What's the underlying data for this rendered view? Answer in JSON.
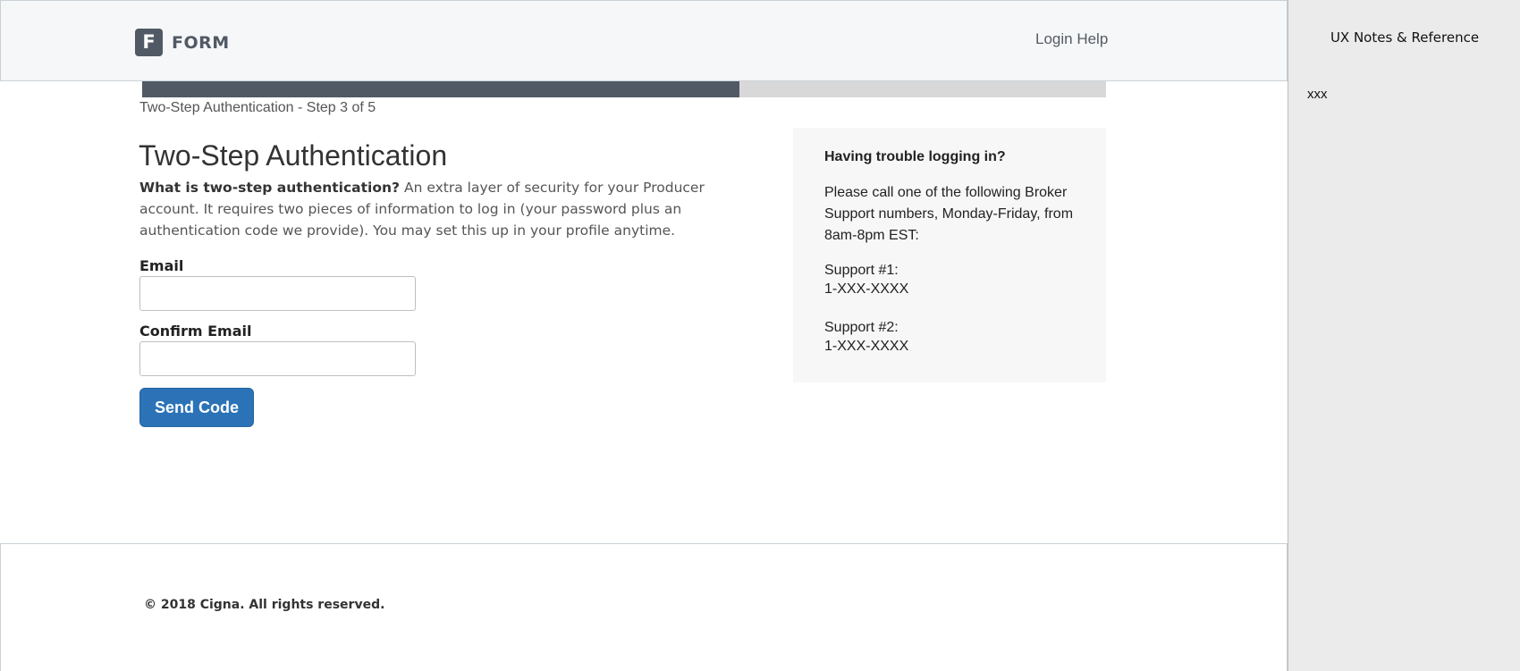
{
  "header": {
    "logo_letter": "F",
    "logo_text": "FORM",
    "login_help": "Login Help"
  },
  "progress": {
    "label": "Two-Step Authentication - Step 3 of 5",
    "fill_fraction": 0.62,
    "fill_color": "#515965",
    "track_color": "#d8d8d8"
  },
  "main": {
    "title": "Two-Step Authentication",
    "intro_bold": "What is two-step authentication?",
    "intro_text": " An extra layer of security for your Producer account. It requires two pieces of information to log in (your password plus an authentication code we provide). You may set this up in your profile anytime.",
    "email_label": "Email",
    "email_value": "",
    "confirm_email_label": "Confirm Email",
    "confirm_email_value": "",
    "send_button": "Send Code",
    "button_color": "#2b73b6"
  },
  "help": {
    "title": "Having trouble logging in?",
    "text": "Please call one of the following Broker Support numbers, Monday-Friday, from 8am-8pm EST:",
    "support": [
      {
        "name": "Support #1:",
        "number": "1-XXX-XXXX"
      },
      {
        "name": "Support #2:",
        "number": "1-XXX-XXXX"
      }
    ]
  },
  "footer": {
    "copyright": "© 2018 Cigna. All rights reserved."
  },
  "ux_panel": {
    "title": "UX Notes & Reference",
    "note": "xxx"
  },
  "icons": {
    "logo": "form-logo-icon"
  }
}
